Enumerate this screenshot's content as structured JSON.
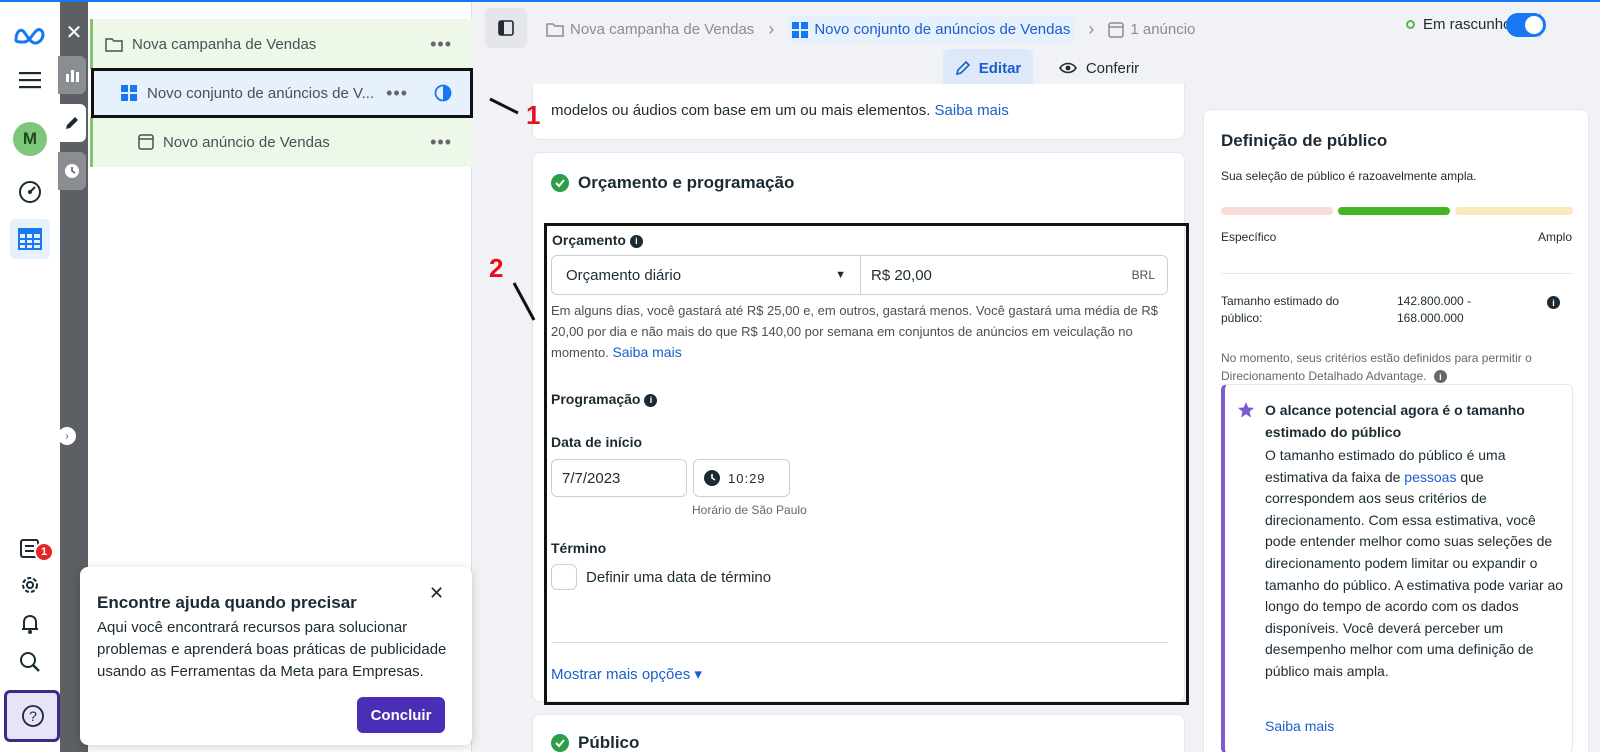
{
  "colors": {
    "accent": "#1877f2",
    "link": "#1b5fcc",
    "success": "#2e9e47",
    "purple": "#4a2fb6",
    "annotation": "#e3101e"
  },
  "rail": {
    "logo_icon": "meta-logo-icon",
    "avatar_initial": "M",
    "notification_count": "1"
  },
  "tree": {
    "campaign": "Nova campanha de Vendas",
    "adset": "Novo conjunto de anúncios de V...",
    "ad": "Novo anúncio de Vendas",
    "more": "•••"
  },
  "popup": {
    "title": "Encontre ajuda quando precisar",
    "body": "Aqui você encontrará recursos para solucionar problemas e aprenderá boas práticas de publicidade usando as Ferramentas da Meta para Empresas.",
    "button": "Concluir"
  },
  "header": {
    "crumb_campaign": "Nova campanha de Vendas",
    "crumb_adset": "Novo conjunto de anúncios de Vendas",
    "crumb_ad": "1 anúncio",
    "status": "Em rascunho",
    "edit": "Editar",
    "review": "Conferir"
  },
  "top_card": {
    "text": "modelos ou áudios com base em um ou mais elementos.",
    "link": "Saiba mais"
  },
  "budget": {
    "section_title": "Orçamento e programação",
    "label": "Orçamento",
    "type_value": "Orçamento diário",
    "amount_value": "R$ 20,00",
    "currency": "BRL",
    "note": "Em alguns dias, você gastará até R$ 25,00 e, em outros, gastará menos. Você gastará uma média de R$ 20,00 por dia e não mais do que R$ 140,00 por semana em conjuntos de anúncios em veiculação no momento.",
    "note_link": "Saiba mais",
    "schedule_label": "Programação",
    "start_label": "Data de início",
    "start_date": "7/7/2023",
    "start_time": "10:29",
    "timezone": "Horário de São Paulo",
    "end_label": "Término",
    "end_checkbox": "Definir uma data de término",
    "more_options": "Mostrar mais opções ▾"
  },
  "audience_card": {
    "title": "Público"
  },
  "annotations": {
    "one": "1",
    "two": "2"
  },
  "audience": {
    "title": "Definição de público",
    "subtitle": "Sua seleção de público é razoavelmente ampla.",
    "gauge_left": "Específico",
    "gauge_right": "Amplo",
    "size_label": "Tamanho estimado do público:",
    "size_value": "142.800.000 - 168.000.000",
    "criteria_note": "No momento, seus critérios estão definidos para permitir o Direcionamento Detalhado Advantage.",
    "tip_title": "O alcance potencial agora é o tamanho estimado do público",
    "tip_body_1": "O tamanho estimado do público é uma estimativa da faixa de",
    "tip_link": "pessoas",
    "tip_body_2": "que correspondem aos seus critérios de direcionamento. Com essa estimativa, você pode entender melhor como suas seleções de direcionamento podem limitar ou expandir o tamanho do público. A estimativa pode variar ao longo do tempo de acordo com os dados disponíveis. Você deverá perceber um desempenho melhor com uma definição de público mais ampla.",
    "tip_more": "Saiba mais"
  }
}
